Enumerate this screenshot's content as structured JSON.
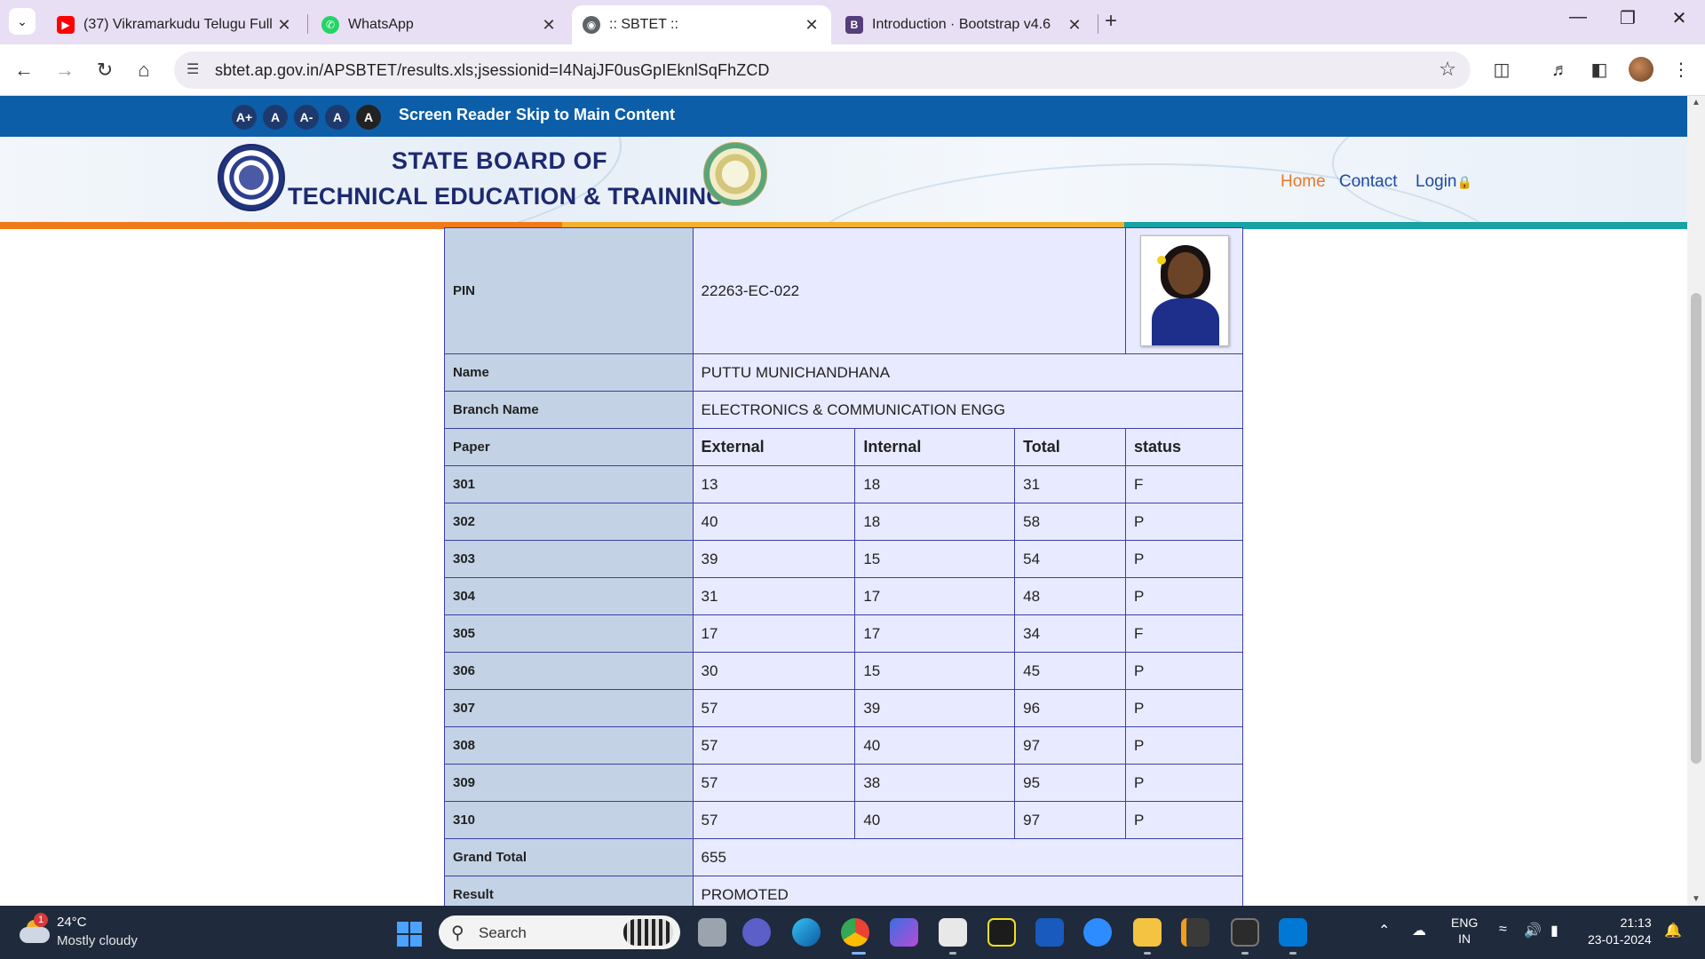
{
  "browser": {
    "tabs": [
      {
        "title": "(37) Vikramarkudu Telugu Full M",
        "favicon": "youtube-icon",
        "active": false
      },
      {
        "title": "WhatsApp",
        "favicon": "whatsapp-icon",
        "active": false
      },
      {
        "title": ":: SBTET ::",
        "favicon": "globe-icon",
        "active": true
      },
      {
        "title": "Introduction · Bootstrap v4.6",
        "favicon": "bootstrap-icon",
        "active": false
      }
    ],
    "url": "sbtet.ap.gov.in/APSBTET/results.xls;jsessionid=I4NajJF0usGpIEknlSqFhZCD"
  },
  "accessibility": {
    "font_buttons": [
      "A+",
      "A",
      "A-",
      "A",
      "A"
    ],
    "screen_reader": "Screen Reader",
    "skip_link": "Skip to Main Content"
  },
  "header": {
    "brand_line1": "STATE BOARD OF",
    "brand_line2": "TECHNICAL EDUCATION & TRAINING",
    "nav": {
      "home": "Home",
      "contact": "Contact",
      "login": "Login"
    }
  },
  "colors": {
    "accessibility_bar": "#0c5ea8",
    "brand_text": "#1d2a70",
    "label_cell": "#c3d3e5",
    "value_cell": "#e8eaff",
    "table_border": "#3b3fa8",
    "stripe_orange": "#f07a1a",
    "stripe_yellow": "#f3b12f",
    "stripe_teal": "#17a2a5"
  },
  "result": {
    "pin_label": "PIN",
    "pin": "22263-EC-022",
    "name_label": "Name",
    "name": "PUTTU MUNICHANDHANA",
    "branch_label": "Branch Name",
    "branch": "ELECTRONICS & COMMUNICATION ENGG",
    "headers": [
      "Paper",
      "External",
      "Internal",
      "Total",
      "status"
    ],
    "rows": [
      [
        "301",
        "13",
        "18",
        "31",
        "F"
      ],
      [
        "302",
        "40",
        "18",
        "58",
        "P"
      ],
      [
        "303",
        "39",
        "15",
        "54",
        "P"
      ],
      [
        "304",
        "31",
        "17",
        "48",
        "P"
      ],
      [
        "305",
        "17",
        "17",
        "34",
        "F"
      ],
      [
        "306",
        "30",
        "15",
        "45",
        "P"
      ],
      [
        "307",
        "57",
        "39",
        "96",
        "P"
      ],
      [
        "308",
        "57",
        "40",
        "97",
        "P"
      ],
      [
        "309",
        "57",
        "38",
        "95",
        "P"
      ],
      [
        "310",
        "57",
        "40",
        "97",
        "P"
      ]
    ],
    "grand_total_label": "Grand Total",
    "grand_total": "655",
    "result_label": "Result",
    "result": "PROMOTED"
  },
  "taskbar": {
    "weather_temp": "24°C",
    "weather_condition": "Mostly cloudy",
    "weather_badge": "1",
    "search_placeholder": "Search",
    "lang_line1": "ENG",
    "lang_line2": "IN",
    "time": "21:13",
    "date": "23-01-2024"
  }
}
